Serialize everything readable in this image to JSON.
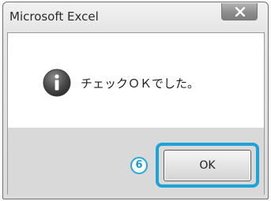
{
  "window": {
    "title": "Microsoft Excel",
    "close_icon": "close-x-icon"
  },
  "message": {
    "icon": "info-icon",
    "text": "チェックＯＫでした。"
  },
  "buttons": {
    "ok_label": "OK"
  },
  "annotation": {
    "step_label": "6"
  },
  "colors": {
    "highlight": "#1fa2d6",
    "footer_bg": "#d9d9d9",
    "content_bg": "#ffffff"
  }
}
